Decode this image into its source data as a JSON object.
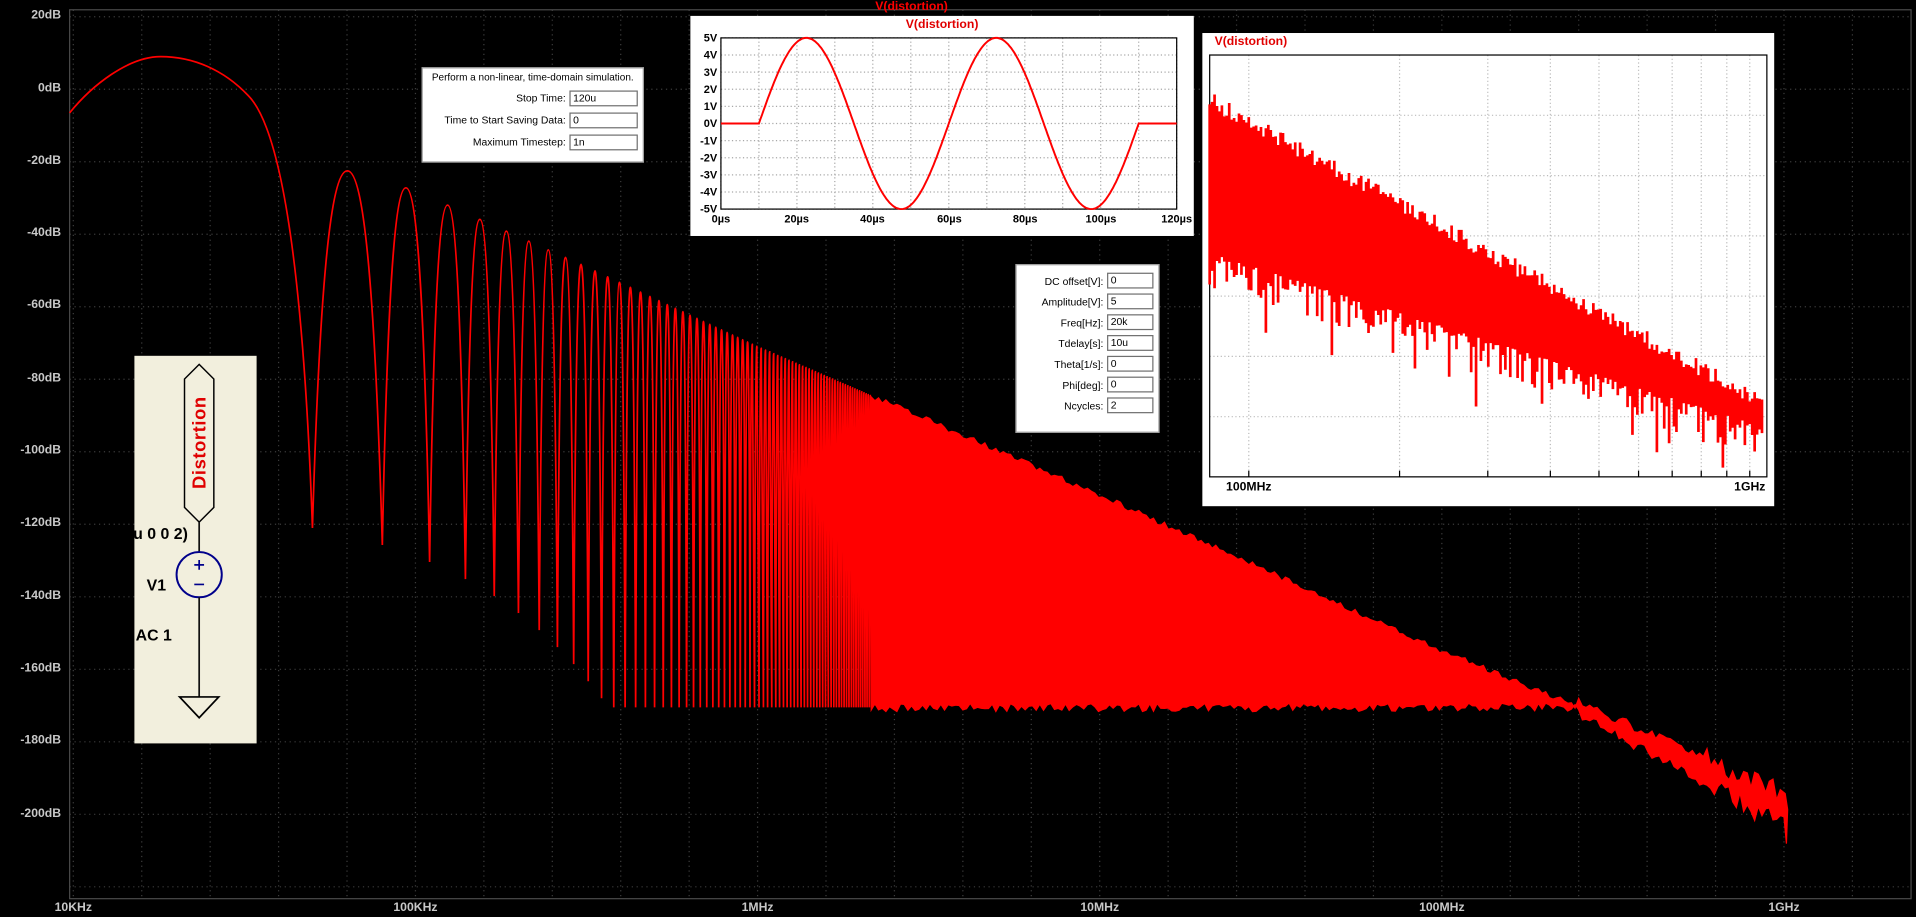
{
  "colors": {
    "trace": "#FF0000",
    "plot_bg": "#000000",
    "grid": "#3C3C3C",
    "axis_text": "#C8C8C8",
    "inset_bg": "#FFFFFF",
    "inset_grid": "#A8A8A8",
    "schematic_bg": "#F2EFDD",
    "symbol": "#00008B",
    "title": "#FF0000"
  },
  "main_plot": {
    "title": "V(distortion)",
    "y_axis": {
      "labels": [
        "20dB",
        "0dB",
        "-20dB",
        "-40dB",
        "-60dB",
        "-80dB",
        "-100dB",
        "-120dB",
        "-140dB",
        "-160dB",
        "-180dB",
        "-200dB"
      ],
      "unit": "dB",
      "max": 20,
      "step": -20
    },
    "x_axis": {
      "labels": [
        "10KHz",
        "100KHz",
        "1MHz",
        "10MHz",
        "100MHz",
        "1GHz"
      ],
      "scale": "log",
      "min_hz": 10000,
      "max_hz": 1000000000
    }
  },
  "chart_data": [
    {
      "name": "main-fft-spectrum",
      "type": "line",
      "title": "V(distortion)",
      "x_scale": "log",
      "x_range_hz": [
        10000,
        1000000000
      ],
      "y_range_db": [
        -220,
        20
      ],
      "main_lobe": {
        "peak_hz": 18000,
        "peak_db": 9,
        "left_edge_db": -6.5
      },
      "nulls": {
        "first_hz": 50000,
        "spacing_hz": 30000,
        "first_depth_db": -121,
        "depth_step_db": -4.7,
        "floor_db": -170.5
      },
      "peak_envelope_db_points": [
        [
          65000,
          -22.5
        ],
        [
          100000,
          -28
        ],
        [
          300000,
          -48
        ],
        [
          1000000,
          -71
        ],
        [
          10000000,
          -112
        ],
        [
          100000000,
          -155
        ],
        [
          250000000,
          -170.5
        ]
      ],
      "tail_db_points": [
        [
          250000000,
          -170.5
        ],
        [
          1000000000,
          -199
        ]
      ],
      "noise_floor_db": -170.5
    },
    {
      "name": "time-domain-waveform",
      "type": "line",
      "title": "V(distortion)",
      "x_range_us": [
        0,
        120
      ],
      "y_range_v": [
        -5,
        5
      ],
      "signal": {
        "shape": "sine",
        "dc_offset_v": 0,
        "amplitude_v": 5,
        "freq_hz": 20000,
        "tdelay_us": 10,
        "ncycles": 2
      }
    },
    {
      "name": "fft-zoom-100mhz-1ghz",
      "type": "line",
      "title": "V(distortion)",
      "x_scale": "log",
      "x_range_hz": [
        100000000,
        1000000000
      ],
      "band_top_frac": [
        0.115,
        0.83
      ],
      "band_bottom_frac": [
        0.47,
        0.88
      ],
      "note": "dense noisy spectrum band descending from left to right"
    }
  ],
  "inset_time": {
    "title": "V(distortion)",
    "y_labels": [
      "5V",
      "4V",
      "3V",
      "2V",
      "1V",
      "0V",
      "-1V",
      "-2V",
      "-3V",
      "-4V",
      "-5V"
    ],
    "x_labels": [
      "0µs",
      "20µs",
      "40µs",
      "60µs",
      "80µs",
      "100µs",
      "120µs"
    ]
  },
  "inset_freq": {
    "title": "V(distortion)",
    "x_labels": [
      "100MHz",
      "1GHz"
    ]
  },
  "sim_dialog": {
    "title": "Perform a non-linear, time-domain simulation.",
    "fields": [
      {
        "label": "Stop Time:",
        "value": "120u"
      },
      {
        "label": "Time to Start Saving Data:",
        "value": "0"
      },
      {
        "label": "Maximum Timestep:",
        "value": "1n"
      }
    ]
  },
  "source_params": {
    "fields": [
      {
        "label": "DC offset[V]:",
        "value": "0"
      },
      {
        "label": "Amplitude[V]:",
        "value": "5"
      },
      {
        "label": "Freq[Hz]:",
        "value": "20k"
      },
      {
        "label": "Tdelay[s]:",
        "value": "10u"
      },
      {
        "label": "Theta[1/s]:",
        "value": "0"
      },
      {
        "label": "Phi[deg]:",
        "value": "0"
      },
      {
        "label": "Ncycles:",
        "value": "2"
      }
    ]
  },
  "schematic": {
    "net_label": "Distortion",
    "clipped_directive": "u 0 0 2)",
    "designator": "V1",
    "value_text": "AC 1"
  }
}
